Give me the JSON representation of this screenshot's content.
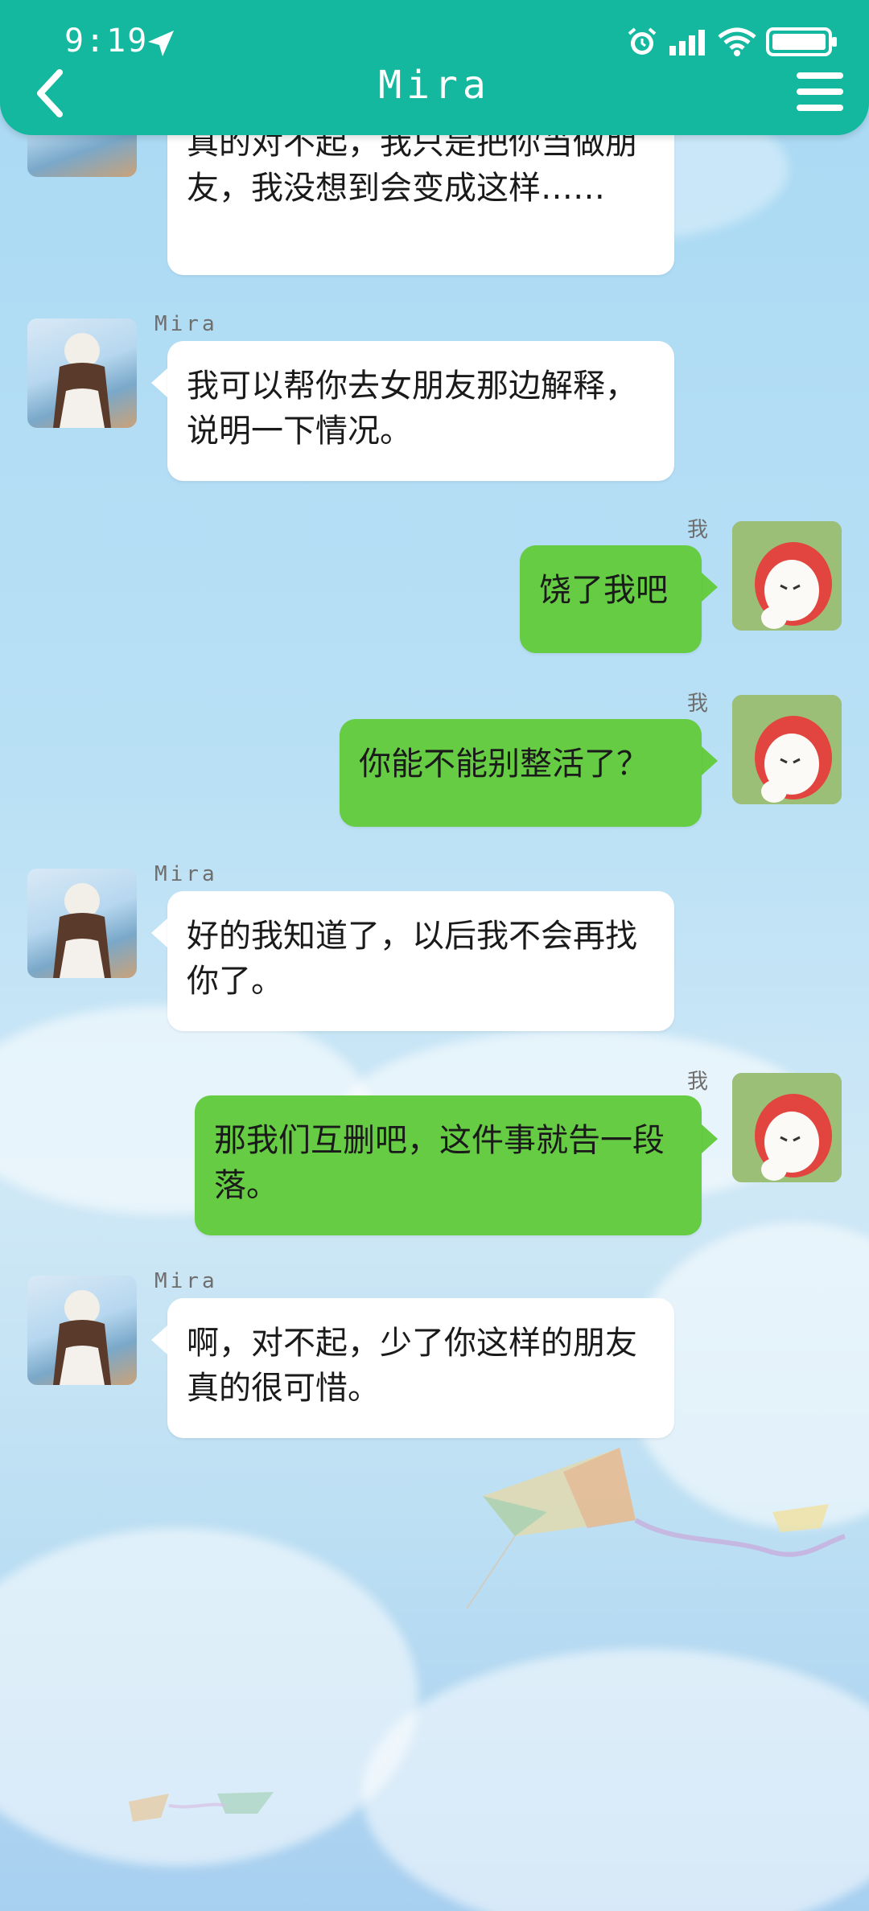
{
  "status_bar": {
    "time": "9:19",
    "icons": [
      "location-arrow-icon",
      "alarm-icon",
      "signal-icon",
      "wifi-icon",
      "battery-icon"
    ]
  },
  "header": {
    "title": "Mira",
    "back_icon": "chevron-left-icon",
    "menu_icon": "menu-icon"
  },
  "colors": {
    "header": "#13b89e",
    "my_bubble": "#66cc44",
    "their_bubble": "#ffffff"
  },
  "messages": [
    {
      "from": "Mira",
      "sender_label": "",
      "text": "真的对不起，我只是把你当做朋友，我没想到会变成这样……"
    },
    {
      "from": "Mira",
      "sender_label": "Mira",
      "text": "我可以帮你去女朋友那边解释，说明一下情况。"
    },
    {
      "from": "me",
      "sender_label": "我",
      "text": "饶了我吧"
    },
    {
      "from": "me",
      "sender_label": "我",
      "text": "你能不能别整活了？"
    },
    {
      "from": "Mira",
      "sender_label": "Mira",
      "text": "好的我知道了，以后我不会再找你了。"
    },
    {
      "from": "me",
      "sender_label": "我",
      "text": "那我们互删吧，这件事就告一段落。"
    },
    {
      "from": "Mira",
      "sender_label": "Mira",
      "text": "啊，对不起，少了你这样的朋友真的很可惜。"
    }
  ]
}
